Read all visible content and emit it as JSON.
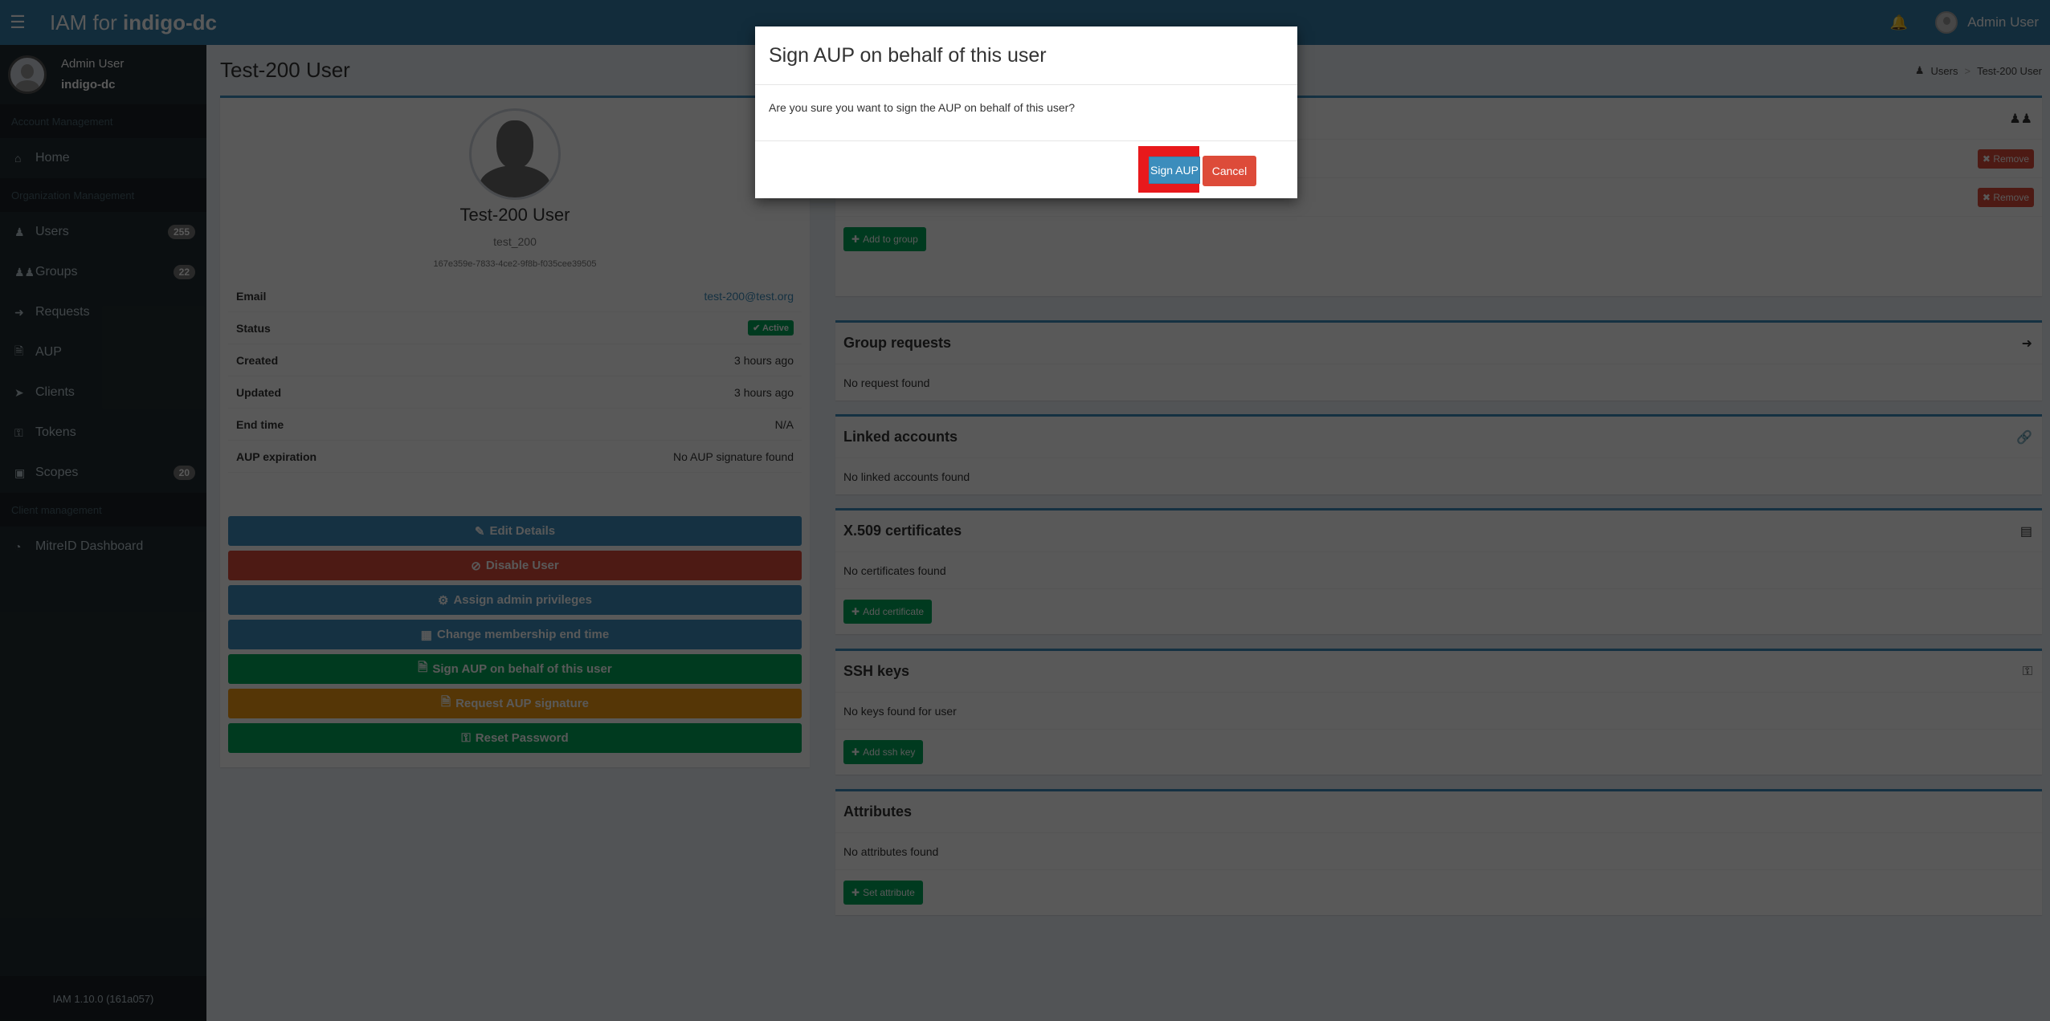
{
  "header": {
    "brand_prefix": "IAM for ",
    "brand_org": "indigo-dc",
    "user_name": "Admin User",
    "menu_icon": "hamburger-icon",
    "bell_icon": "bell-icon"
  },
  "sidebar": {
    "user_name": "Admin User",
    "user_org": "indigo-dc",
    "sections": {
      "account": "Account Management",
      "organization": "Organization Management",
      "client": "Client management"
    },
    "items": [
      {
        "label": "Home",
        "icon": "home-icon"
      },
      {
        "label": "Users",
        "icon": "user-icon",
        "badge": "255"
      },
      {
        "label": "Groups",
        "icon": "users-icon",
        "badge": "22"
      },
      {
        "label": "Requests",
        "icon": "sign-in-icon"
      },
      {
        "label": "AUP",
        "icon": "file-text-icon"
      },
      {
        "label": "Clients",
        "icon": "rocket-icon"
      },
      {
        "label": "Tokens",
        "icon": "key-icon"
      },
      {
        "label": "Scopes",
        "icon": "id-badge-icon",
        "badge": "20"
      },
      {
        "label": "MitreID Dashboard",
        "icon": "dashboard-icon"
      }
    ],
    "footer": "IAM 1.10.0 (161a057)"
  },
  "page": {
    "title": "Test-200 User",
    "breadcrumb": [
      "Users",
      "Test-200 User"
    ]
  },
  "profile": {
    "name": "Test-200 User",
    "username": "test_200",
    "uuid": "167e359e-7833-4ce2-9f8b-f035cee39505",
    "rows": [
      {
        "label": "Email",
        "value": "test-200@test.org"
      },
      {
        "label": "Status",
        "value": "Active"
      },
      {
        "label": "Created",
        "value": "3 hours ago"
      },
      {
        "label": "Updated",
        "value": "3 hours ago"
      },
      {
        "label": "End time",
        "value": "N/A"
      },
      {
        "label": "AUP expiration",
        "value": "No AUP signature found"
      }
    ],
    "actions": [
      {
        "label": "Edit Details",
        "icon": "pencil-icon",
        "color": "#3c8dbc"
      },
      {
        "label": "Disable User",
        "icon": "ban-icon",
        "color": "#dd4b39"
      },
      {
        "label": "Assign admin privileges",
        "icon": "gear-icon",
        "color": "#3c8dbc"
      },
      {
        "label": "Change membership end time",
        "icon": "calendar-icon",
        "color": "#3c8dbc"
      },
      {
        "label": "Sign AUP on behalf of this user",
        "icon": "file-icon",
        "color": "#00a65a"
      },
      {
        "label": "Request AUP signature",
        "icon": "file-icon",
        "color": "#f39c12"
      },
      {
        "label": "Reset Password",
        "icon": "key-icon",
        "color": "#00a65a"
      }
    ]
  },
  "groups": {
    "remove_label": "Remove",
    "add_label": "Add to group"
  },
  "panels": {
    "group_requests": {
      "title": "Group requests",
      "empty": "No request found"
    },
    "linked_accounts": {
      "title": "Linked accounts",
      "empty": "No linked accounts found"
    },
    "certificates": {
      "title": "X.509 certificates",
      "empty": "No certificates found",
      "button": "Add certificate"
    },
    "ssh_keys": {
      "title": "SSH keys",
      "empty": "No keys found for user",
      "button": "Add ssh key"
    },
    "attributes": {
      "title": "Attributes",
      "empty": "No attributes found",
      "button": "Set attribute"
    }
  },
  "modal": {
    "title": "Sign AUP on behalf of this user",
    "body": "Are you sure you want to sign the AUP on behalf of this user?",
    "confirm_label": "Sign AUP",
    "cancel_label": "Cancel",
    "highlight_color": "#e8191c"
  }
}
